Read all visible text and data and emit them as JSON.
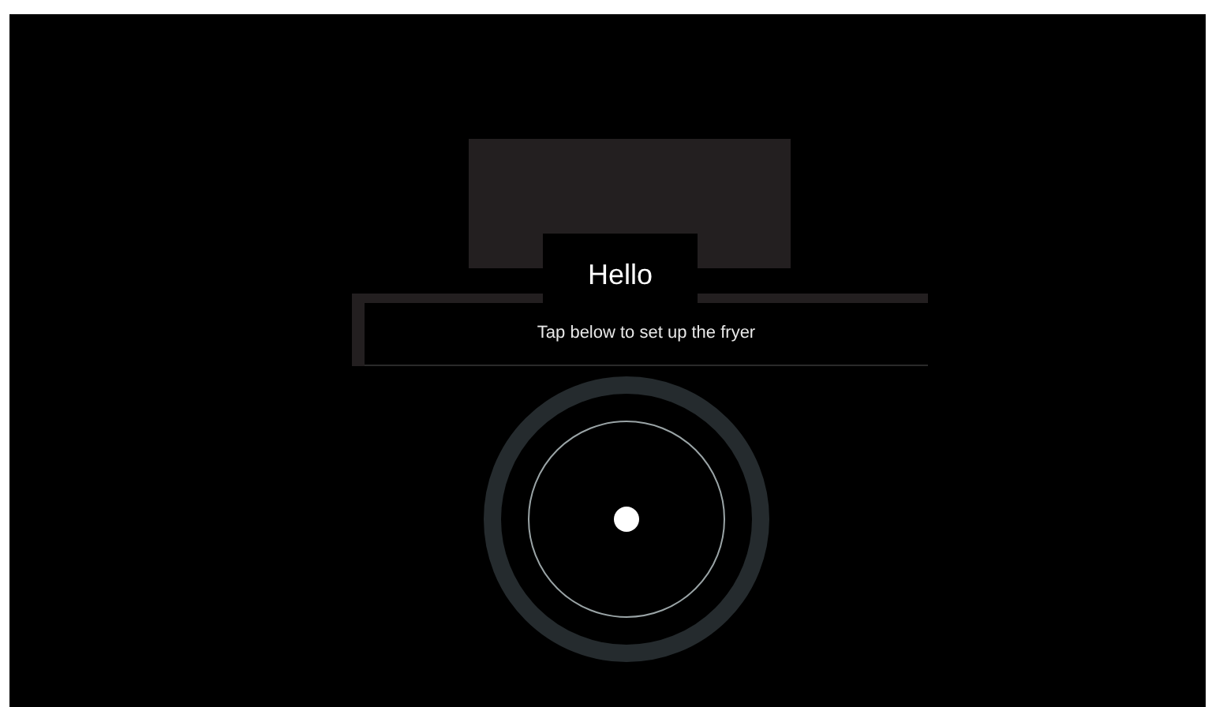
{
  "greeting": "Hello",
  "instruction": "Tap below to set up the fryer"
}
